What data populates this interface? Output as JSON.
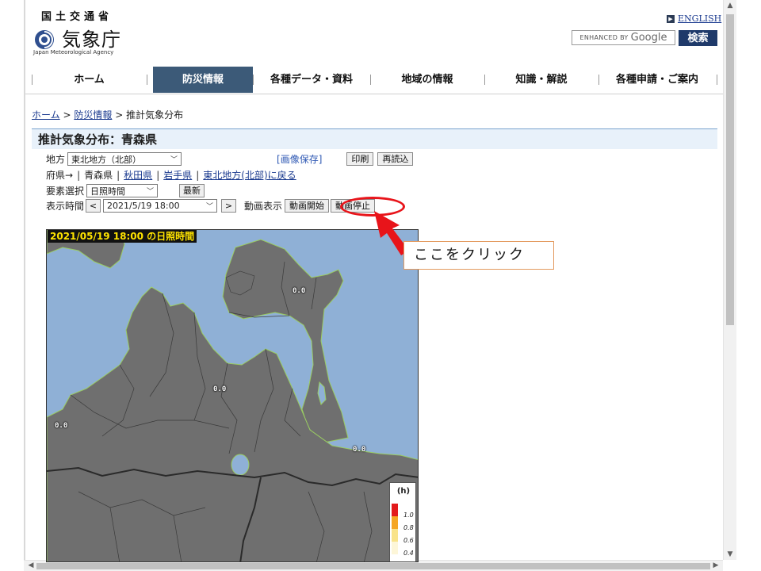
{
  "header": {
    "ministry": "国土交通省",
    "agency_name": "気象庁",
    "agency_sub": "Japan Meteorological Agency",
    "english_link": "ENGLISH",
    "search_enhanced": "ENHANCED BY",
    "search_brand": "Google",
    "search_button": "検索"
  },
  "nav": {
    "items": [
      {
        "label": "ホーム",
        "active": false
      },
      {
        "label": "防災情報",
        "active": true
      },
      {
        "label": "各種データ・資料",
        "active": false
      },
      {
        "label": "地域の情報",
        "active": false
      },
      {
        "label": "知識・解説",
        "active": false
      },
      {
        "label": "各種申請・ご案内",
        "active": false
      }
    ]
  },
  "breadcrumb": {
    "home": "ホーム",
    "sep": ">",
    "disaster": "防災情報",
    "current": "推計気象分布"
  },
  "page": {
    "title": "推計気象分布：青森県"
  },
  "controls": {
    "region_label": "地方",
    "region_value": "東北地方（北部）",
    "save_image": "[画像保存]",
    "print": "印刷",
    "reload": "再読込",
    "pref_label": "府県→",
    "pref_current": "青森県",
    "pref_links": [
      "秋田県",
      "岩手県",
      "東北地方(北部)に戻る"
    ],
    "element_label": "要素選択",
    "element_value": "日照時間",
    "latest": "最新",
    "time_label": "表示時間",
    "time_prev": "<",
    "time_value": "2021/5/19 18:00",
    "time_next": ">",
    "anim_label": "動画表示",
    "anim_start": "動画開始",
    "anim_stop": "動画停止"
  },
  "map": {
    "caption": "2021/05/19 18:00 の日照時間",
    "values": [
      "0.0",
      "0.0",
      "0.0",
      "0.0"
    ],
    "legend_unit": "(h)",
    "legend_levels": [
      "1.0",
      "0.8",
      "0.6",
      "0.4"
    ],
    "colors": {
      "sea": "#8fb0d6",
      "land": "#6f6f6f",
      "border": "#3a3a3a"
    }
  },
  "annotation": {
    "callout": "ここをクリック",
    "color": "#e8141a"
  }
}
